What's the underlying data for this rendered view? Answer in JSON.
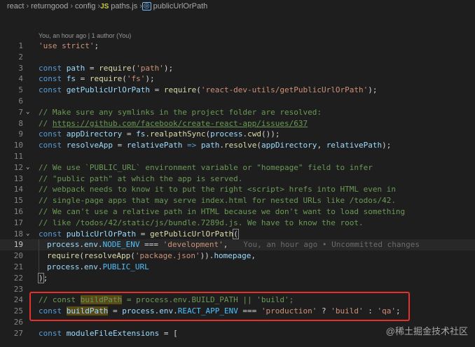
{
  "breadcrumb": {
    "items": [
      "react",
      "returngood",
      "config",
      "paths.js",
      "publicUrlOrPath"
    ],
    "js_badge": "JS"
  },
  "codelens": "You, an hour ago | 1 author (You)",
  "blame": "You, an hour ago • Uncommitted changes",
  "watermark": "@稀土掘金技术社区",
  "lines": [
    {
      "n": "1",
      "tokens": [
        [
          "str",
          "'use strict'"
        ],
        [
          "op",
          ";"
        ]
      ]
    },
    {
      "n": "2",
      "tokens": []
    },
    {
      "n": "3",
      "tokens": [
        [
          "kw",
          "const "
        ],
        [
          "var",
          "path"
        ],
        [
          "op",
          " = "
        ],
        [
          "fn",
          "require"
        ],
        [
          "op",
          "("
        ],
        [
          "str",
          "'path'"
        ],
        [
          "op",
          ");"
        ]
      ]
    },
    {
      "n": "4",
      "tokens": [
        [
          "kw",
          "const "
        ],
        [
          "var",
          "fs"
        ],
        [
          "op",
          " = "
        ],
        [
          "fn",
          "require"
        ],
        [
          "op",
          "("
        ],
        [
          "str",
          "'fs'"
        ],
        [
          "op",
          ");"
        ]
      ]
    },
    {
      "n": "5",
      "tokens": [
        [
          "kw",
          "const "
        ],
        [
          "var",
          "getPublicUrlOrPath"
        ],
        [
          "op",
          " = "
        ],
        [
          "fn",
          "require"
        ],
        [
          "op",
          "("
        ],
        [
          "str",
          "'react-dev-utils/getPublicUrlOrPath'"
        ],
        [
          "op",
          ");"
        ]
      ]
    },
    {
      "n": "6",
      "tokens": []
    },
    {
      "n": "7",
      "fold": true,
      "tokens": [
        [
          "cm",
          "// Make sure any symlinks in the project folder are resolved:"
        ]
      ]
    },
    {
      "n": "8",
      "tokens": [
        [
          "cm",
          "// "
        ],
        [
          "url",
          "https://github.com/facebook/create-react-app/issues/637"
        ]
      ]
    },
    {
      "n": "9",
      "tokens": [
        [
          "kw",
          "const "
        ],
        [
          "var",
          "appDirectory"
        ],
        [
          "op",
          " = "
        ],
        [
          "var",
          "fs"
        ],
        [
          "op",
          "."
        ],
        [
          "fn",
          "realpathSync"
        ],
        [
          "op",
          "("
        ],
        [
          "var",
          "process"
        ],
        [
          "op",
          "."
        ],
        [
          "fn",
          "cwd"
        ],
        [
          "op",
          "());"
        ]
      ]
    },
    {
      "n": "10",
      "tokens": [
        [
          "kw",
          "const "
        ],
        [
          "var",
          "resolveApp"
        ],
        [
          "op",
          " = "
        ],
        [
          "var",
          "relativePath"
        ],
        [
          "kw",
          " => "
        ],
        [
          "var",
          "path"
        ],
        [
          "op",
          "."
        ],
        [
          "fn",
          "resolve"
        ],
        [
          "op",
          "("
        ],
        [
          "var",
          "appDirectory"
        ],
        [
          "op",
          ", "
        ],
        [
          "var",
          "relativePath"
        ],
        [
          "op",
          ");"
        ]
      ]
    },
    {
      "n": "11",
      "tokens": []
    },
    {
      "n": "12",
      "fold": true,
      "tokens": [
        [
          "cm",
          "// We use `PUBLIC_URL` environment variable or \"homepage\" field to infer"
        ]
      ]
    },
    {
      "n": "13",
      "tokens": [
        [
          "cm",
          "// \"public path\" at which the app is served."
        ]
      ]
    },
    {
      "n": "14",
      "tokens": [
        [
          "cm",
          "// webpack needs to know it to put the right <script> hrefs into HTML even in"
        ]
      ]
    },
    {
      "n": "15",
      "tokens": [
        [
          "cm",
          "// single-page apps that may serve index.html for nested URLs like /todos/42."
        ]
      ]
    },
    {
      "n": "16",
      "tokens": [
        [
          "cm",
          "// We can't use a relative path in HTML because we don't want to load something"
        ]
      ]
    },
    {
      "n": "17",
      "tokens": [
        [
          "cm",
          "// like /todos/42/static/js/bundle.7289d.js. We have to know the root."
        ]
      ]
    },
    {
      "n": "18",
      "fold": true,
      "tokens": [
        [
          "kw",
          "const "
        ],
        [
          "var",
          "publicUrlOrPath"
        ],
        [
          "op",
          " = "
        ],
        [
          "fn",
          "getPublicUrlOrPath"
        ],
        [
          "bracket",
          "("
        ]
      ]
    },
    {
      "n": "19",
      "active": true,
      "indent": true,
      "blame": true,
      "tokens": [
        [
          "var",
          "process"
        ],
        [
          "op",
          "."
        ],
        [
          "var",
          "env"
        ],
        [
          "op",
          "."
        ],
        [
          "const",
          "NODE_ENV"
        ],
        [
          "op",
          " === "
        ],
        [
          "str",
          "'development'"
        ],
        [
          "op",
          ","
        ]
      ]
    },
    {
      "n": "20",
      "indent": true,
      "tokens": [
        [
          "fn",
          "require"
        ],
        [
          "op",
          "("
        ],
        [
          "fn",
          "resolveApp"
        ],
        [
          "op",
          "("
        ],
        [
          "str",
          "'package.json'"
        ],
        [
          "op",
          "))."
        ],
        [
          "var",
          "homepage"
        ],
        [
          "op",
          ","
        ]
      ]
    },
    {
      "n": "21",
      "indent": true,
      "tokens": [
        [
          "var",
          "process"
        ],
        [
          "op",
          "."
        ],
        [
          "var",
          "env"
        ],
        [
          "op",
          "."
        ],
        [
          "const",
          "PUBLIC_URL"
        ]
      ]
    },
    {
      "n": "22",
      "tokens": [
        [
          "bracket",
          ")"
        ],
        [
          "op",
          ";"
        ]
      ]
    },
    {
      "n": "23",
      "tokens": []
    },
    {
      "n": "24",
      "git": true,
      "tokens": [
        [
          "cm",
          "// const "
        ],
        [
          "cmhl",
          "buildPath"
        ],
        [
          "cm",
          " = process.env.BUILD_PATH || 'build';"
        ]
      ]
    },
    {
      "n": "25",
      "git": true,
      "tokens": [
        [
          "kw",
          "const "
        ],
        [
          "varhl",
          "buildPath"
        ],
        [
          "op",
          " = "
        ],
        [
          "var",
          "process"
        ],
        [
          "op",
          "."
        ],
        [
          "var",
          "env"
        ],
        [
          "op",
          "."
        ],
        [
          "const",
          "REACT_APP_ENV"
        ],
        [
          "op",
          " === "
        ],
        [
          "str",
          "'production'"
        ],
        [
          "op",
          " ? "
        ],
        [
          "str",
          "'build'"
        ],
        [
          "op",
          " : "
        ],
        [
          "str",
          "'qa'"
        ],
        [
          "op",
          ";"
        ]
      ]
    },
    {
      "n": "26",
      "tokens": []
    },
    {
      "n": "27",
      "tokens": [
        [
          "kw",
          "const "
        ],
        [
          "var",
          "moduleFileExtensions"
        ],
        [
          "op",
          " = ["
        ]
      ]
    }
  ]
}
